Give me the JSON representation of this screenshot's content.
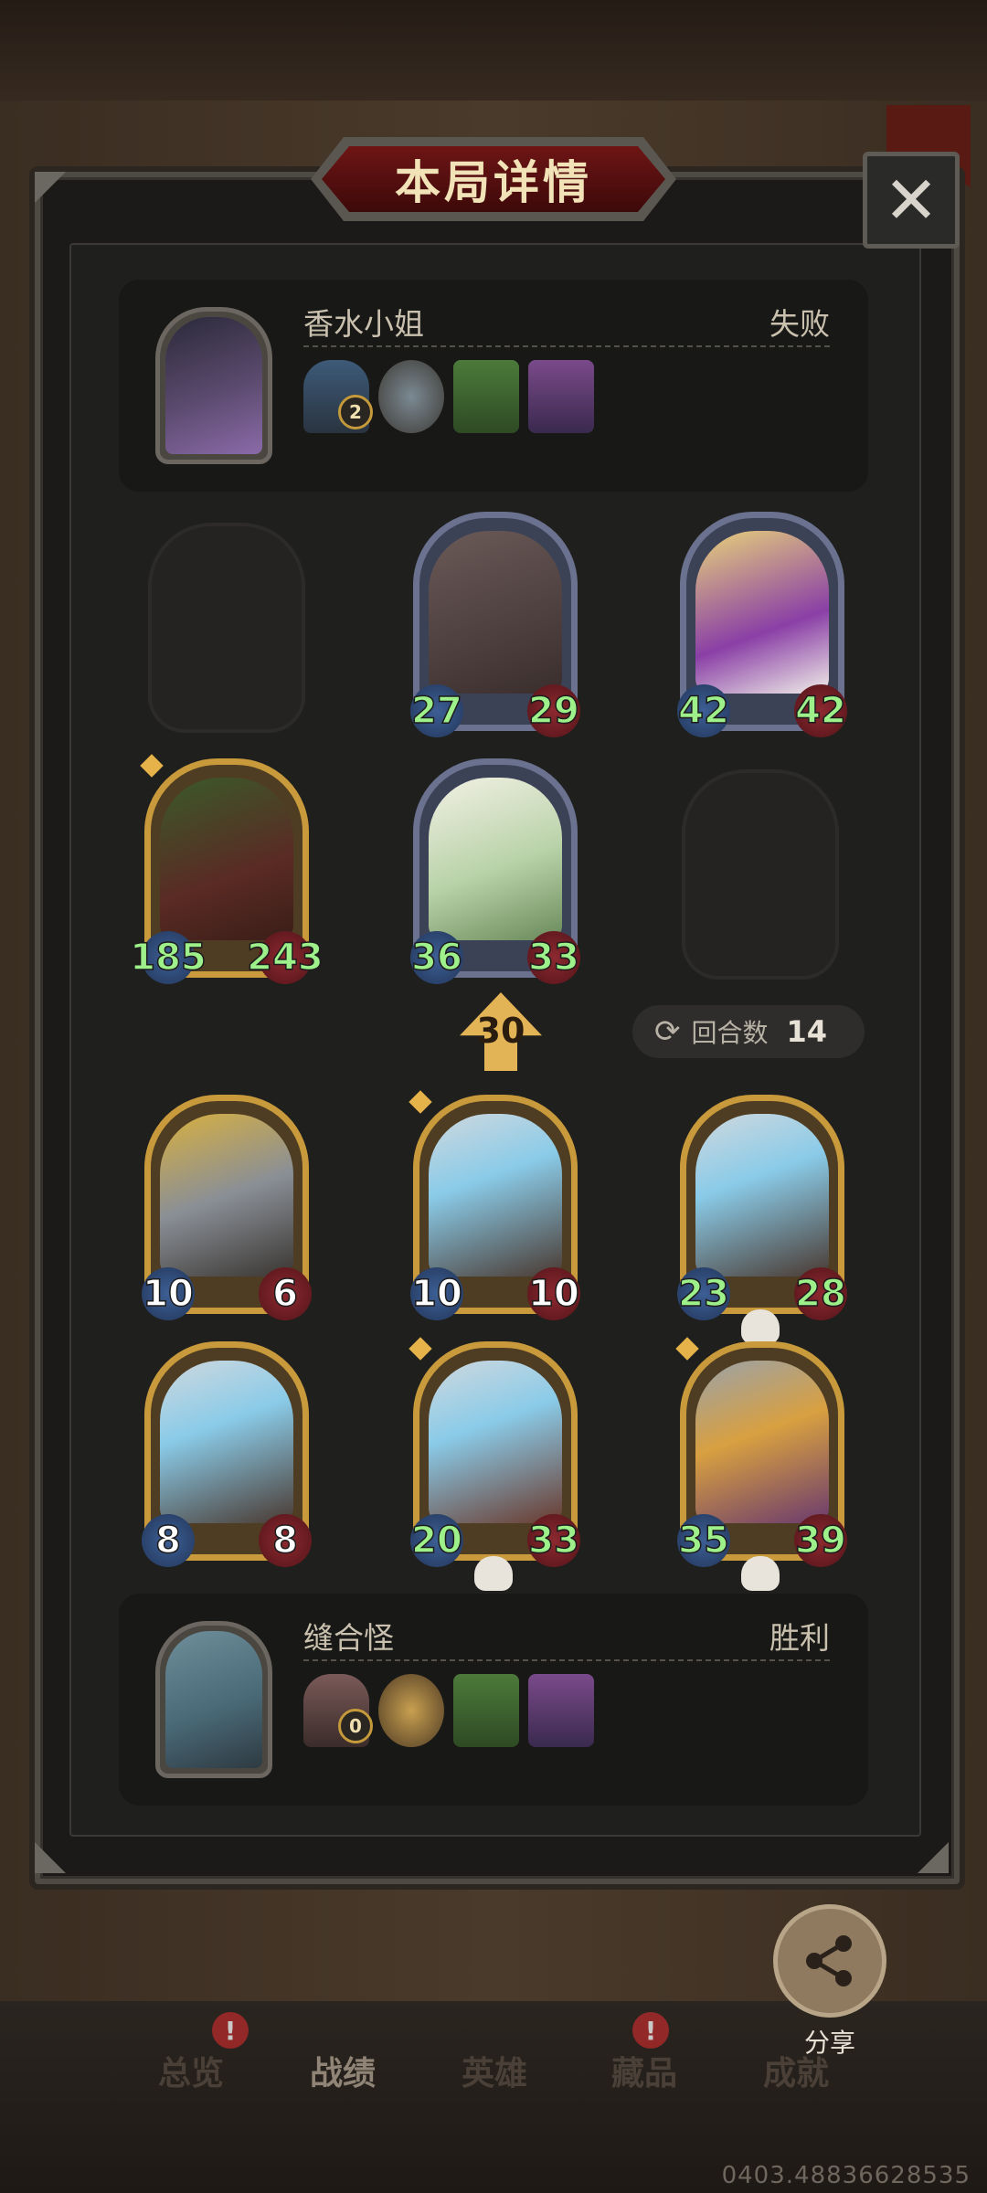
{
  "title": "本局详情",
  "close_glyph": "✕",
  "top_player": {
    "name": "香水小姐",
    "result": "失败",
    "item_badge": "2"
  },
  "bottom_player": {
    "name": "缝合怪",
    "result": "胜利",
    "item_badge": "0"
  },
  "opponent_board": [
    {
      "atk": "27",
      "hp": "29"
    },
    {
      "atk": "42",
      "hp": "42"
    },
    {
      "atk": "185",
      "hp": "243"
    },
    {
      "atk": "36",
      "hp": "33"
    }
  ],
  "arrow_value": "30",
  "turns": {
    "label": "回合数",
    "value": "14"
  },
  "player_board": [
    {
      "atk": "10",
      "hp": "6"
    },
    {
      "atk": "10",
      "hp": "10"
    },
    {
      "atk": "23",
      "hp": "28"
    },
    {
      "atk": "8",
      "hp": "8"
    },
    {
      "atk": "20",
      "hp": "33"
    },
    {
      "atk": "35",
      "hp": "39"
    }
  ],
  "nav": {
    "tabs": [
      "总览",
      "战绩",
      "英雄",
      "藏品",
      "成就"
    ],
    "badge": "!"
  },
  "share_label": "分享",
  "footer_id": "0403.48836628535"
}
